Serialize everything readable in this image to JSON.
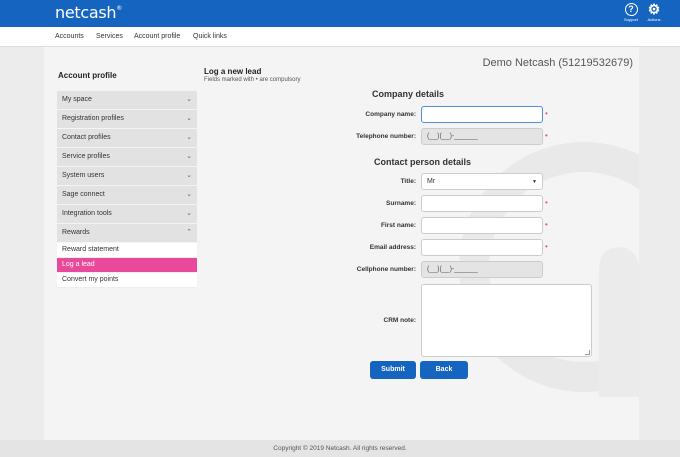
{
  "brand": {
    "logo_text": "netcash",
    "logo_mark": "®"
  },
  "topbar": {
    "support_label": "Support",
    "actions_label": "Actions",
    "support_glyph": "?",
    "actions_glyph": "⚙",
    "background": "#1565c0"
  },
  "menu": [
    "Accounts",
    "Services",
    "Account profile",
    "Quick links"
  ],
  "account_title": "Demo Netcash (51219532679)",
  "sidebar": {
    "title": "Account profile",
    "items": [
      {
        "label": "My space",
        "chevron": "⌄"
      },
      {
        "label": "Registration profiles",
        "chevron": "⌄"
      },
      {
        "label": "Contact profiles",
        "chevron": "⌄"
      },
      {
        "label": "Service profiles",
        "chevron": "⌄"
      },
      {
        "label": "System users",
        "chevron": "⌄"
      },
      {
        "label": "Sage connect",
        "chevron": "⌄"
      },
      {
        "label": "Integration tools",
        "chevron": "⌄"
      },
      {
        "label": "Rewards",
        "chevron": "⌃"
      }
    ],
    "sub_items": [
      "Reward statement",
      "Log a lead",
      "Convert my points"
    ],
    "active_sub": "Log a lead"
  },
  "form": {
    "title": "Log a new lead",
    "subtitle": "Fields marked with • are compulsory",
    "company_section": "Company details",
    "contact_section": "Contact person details",
    "required_mark": "•",
    "fields": {
      "company_name": {
        "label": "Company name:",
        "value": ""
      },
      "telephone": {
        "label": "Telephone number:",
        "value": "(__)(__)-______"
      },
      "title": {
        "label": "Title:",
        "value": "Mr",
        "caret": "▼"
      },
      "surname": {
        "label": "Surname:",
        "value": ""
      },
      "first_name": {
        "label": "First name:",
        "value": ""
      },
      "email": {
        "label": "Email address:",
        "value": ""
      },
      "cellphone": {
        "label": "Cellphone number:",
        "value": "(__)(__)-______"
      },
      "crm_note": {
        "label": "CRM note:",
        "value": ""
      }
    },
    "submit_label": "Submit",
    "back_label": "Back"
  },
  "footer": "Copyright © 2019 Netcash. All rights reserved.",
  "colors": {
    "primary": "#1565c0",
    "accent": "#e8499a"
  }
}
